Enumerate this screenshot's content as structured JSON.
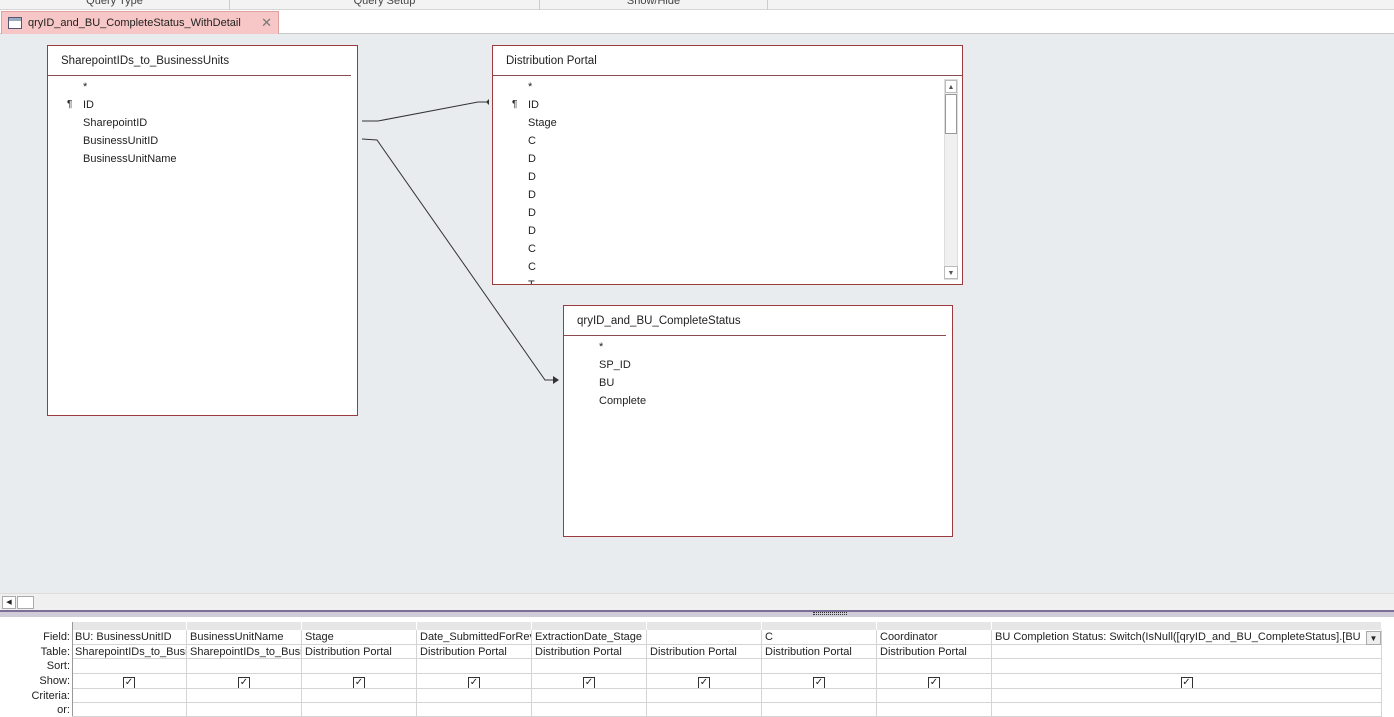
{
  "ribbon": {
    "groups": [
      "Query Type",
      "Query Setup",
      "Show/Hide"
    ]
  },
  "tab": {
    "title": "qryID_and_BU_CompleteStatus_WithDetail",
    "close": "✕"
  },
  "tables": [
    {
      "name": "SharepointIDs_to_BusinessUnits",
      "fields": [
        {
          "n": "*",
          "key": false
        },
        {
          "n": "ID",
          "key": true
        },
        {
          "n": "SharepointID",
          "key": false
        },
        {
          "n": "BusinessUnitID",
          "key": false
        },
        {
          "n": "BusinessUnitName",
          "key": false
        }
      ]
    },
    {
      "name": "Distribution Portal",
      "fields": [
        {
          "n": "*",
          "key": false
        },
        {
          "n": "ID",
          "key": true
        },
        {
          "n": "Stage",
          "key": false
        },
        {
          "n": "C",
          "key": false
        },
        {
          "n": "D",
          "key": false
        },
        {
          "n": "D",
          "key": false
        },
        {
          "n": "D",
          "key": false
        },
        {
          "n": "D",
          "key": false
        },
        {
          "n": "D",
          "key": false
        },
        {
          "n": "C",
          "key": false
        },
        {
          "n": "C",
          "key": false
        },
        {
          "n": "T",
          "key": false
        }
      ]
    },
    {
      "name": "qryID_and_BU_CompleteStatus",
      "fields": [
        {
          "n": "*",
          "key": false
        },
        {
          "n": "SP_ID",
          "key": false
        },
        {
          "n": "BU",
          "key": false
        },
        {
          "n": "Complete",
          "key": false
        }
      ]
    }
  ],
  "grid": {
    "row_labels": [
      "Field:",
      "Table:",
      "Sort:",
      "Show:",
      "Criteria:",
      "or:"
    ],
    "columns": [
      {
        "field": "BU: BusinessUnitID",
        "table": "SharepointIDs_to_BusinessUnits",
        "show": true
      },
      {
        "field": "BusinessUnitName",
        "table": "SharepointIDs_to_BusinessUnits",
        "show": true
      },
      {
        "field": "Stage",
        "table": "Distribution Portal",
        "show": true
      },
      {
        "field": "Date_SubmittedForReview",
        "table": "Distribution Portal",
        "show": true
      },
      {
        "field": "ExtractionDate_Stage",
        "table": "Distribution Portal",
        "show": true
      },
      {
        "field": "",
        "table": "Distribution Portal",
        "show": true
      },
      {
        "field": "C",
        "table": "Distribution Portal",
        "show": true
      },
      {
        "field": "Coordinator",
        "table": "Distribution Portal",
        "show": true
      },
      {
        "field": "BU Completion Status: Switch(IsNull([qryID_and_BU_CompleteStatus].[BU",
        "table": "",
        "show": true
      }
    ]
  }
}
